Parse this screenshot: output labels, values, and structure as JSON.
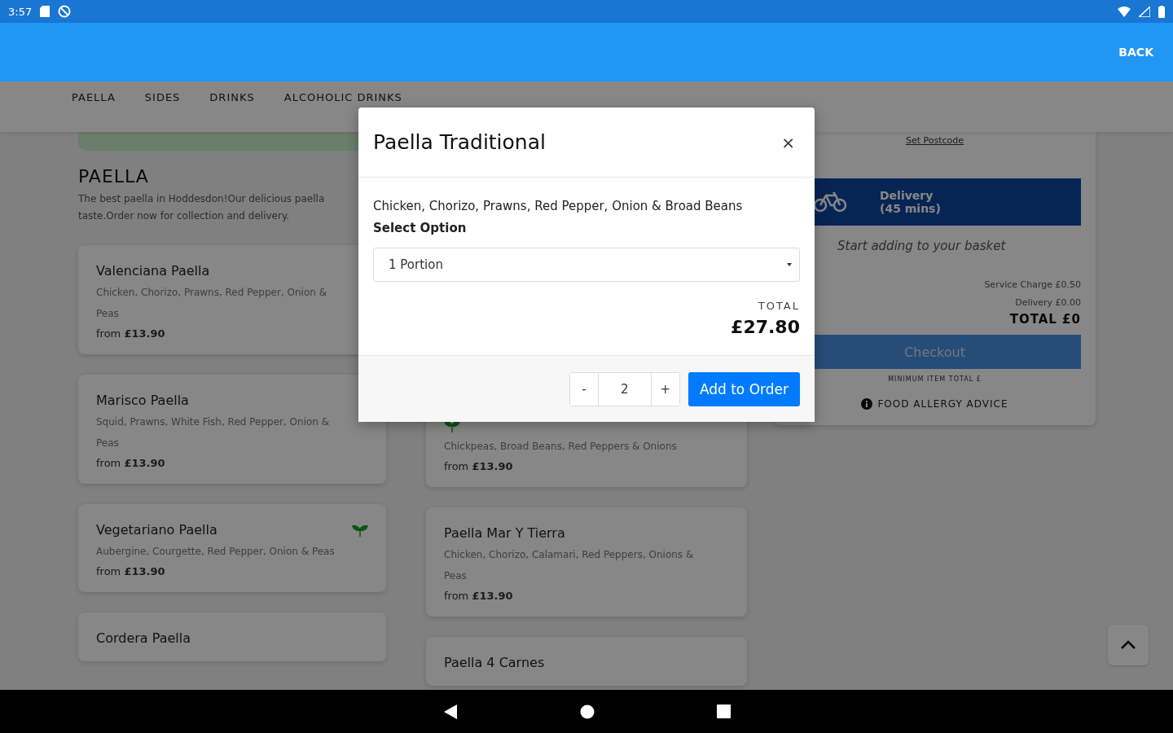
{
  "status_bar": {
    "time": "3:57"
  },
  "app_bar": {
    "action": "BACK"
  },
  "category_tabs": [
    {
      "label": "PAELLA"
    },
    {
      "label": "SIDES"
    },
    {
      "label": "DRINKS"
    },
    {
      "label": "ALCOHOLIC DRINKS"
    }
  ],
  "menu": {
    "heading": "PAELLA",
    "description": "The best paella in Hoddesdon!Our delicious paella taste.Order now for collection and delivery.",
    "left_items": [
      {
        "name": "Valenciana Paella",
        "description": "Chicken, Chorizo, Prawns, Red Pepper, Onion & Peas",
        "price_prefix": "from",
        "price": "£13.90",
        "vegetarian": false
      },
      {
        "name": "Marisco Paella",
        "description": "Squid, Prawns, White Fish, Red Pepper, Onion & Peas",
        "price_prefix": "from",
        "price": "£13.90",
        "vegetarian": false
      },
      {
        "name": "Vegetariano Paella",
        "description": "Aubergine, Courgette, Red Pepper, Onion & Peas",
        "price_prefix": "from",
        "price": "£13.90",
        "vegetarian": true
      },
      {
        "name": "Cordera Paella"
      }
    ],
    "middle_items": [
      {
        "description": "Chickpeas, Broad Beans, Red Peppers & Onions",
        "price_prefix": "from",
        "price": "£13.90",
        "vegetarian": true
      },
      {
        "name": "Paella Mar Y Tierra",
        "description": "Chicken, Chorizo, Calamari, Red Peppers, Onions & Peas",
        "price_prefix": "from",
        "price": "£13.90",
        "vegetarian": false
      },
      {
        "name": "Paella 4 Carnes"
      }
    ]
  },
  "basket": {
    "set_postcode": "Set Postcode",
    "delivery_label": "Delivery",
    "delivery_time": "(45 mins)",
    "empty_message": "Start adding to your basket",
    "service_charge": "Service Charge £0.50",
    "delivery_fee": "Delivery £0.00",
    "total": "TOTAL £0",
    "checkout": "Checkout",
    "minimum": "MINIMUM ITEM TOTAL £",
    "allergy": "FOOD ALLERGY ADVICE"
  },
  "modal": {
    "title": "Paella Traditional",
    "close": "×",
    "description": "Chicken, Chorizo, Prawns, Red Pepper, Onion & Broad Beans",
    "option_label": "Select Option",
    "option_value": "1 Portion",
    "total_label": "TOTAL",
    "total": "£27.80",
    "minus": "-",
    "quantity": "2",
    "plus": "+",
    "add": "Add to Order"
  }
}
